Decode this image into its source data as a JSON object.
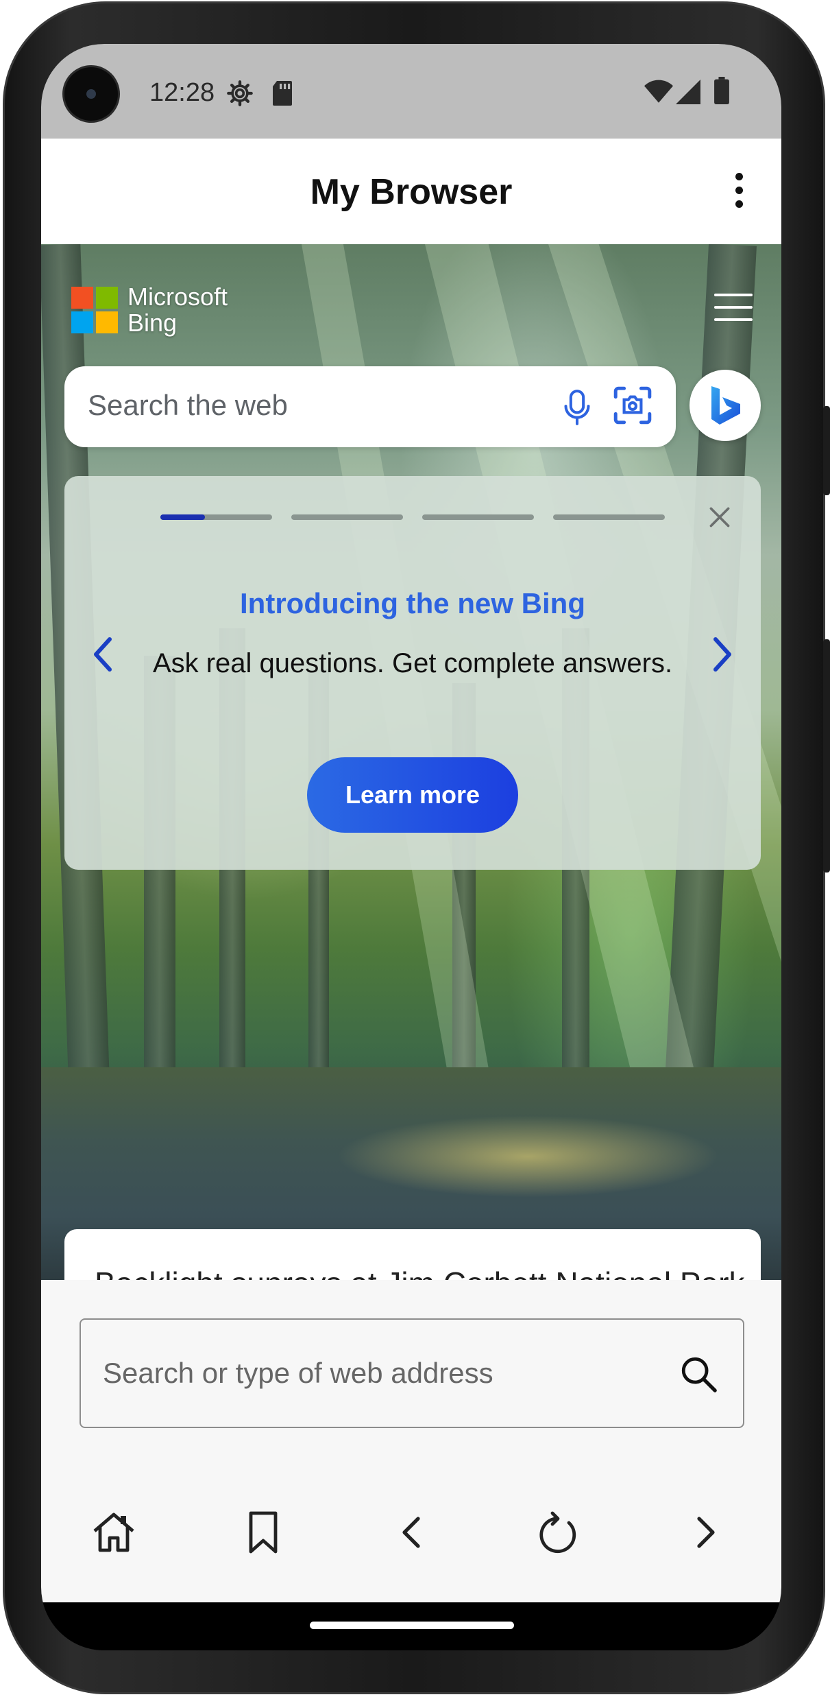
{
  "status_bar": {
    "time": "12:28"
  },
  "app_bar": {
    "title": "My Browser"
  },
  "bing": {
    "logo_line1": "Microsoft",
    "logo_line2": "Bing",
    "search_placeholder": "Search the web"
  },
  "promo": {
    "title": "Introducing the new Bing",
    "body": "Ask real questions. Get complete answers.",
    "button_label": "Learn more",
    "slide_count": 4,
    "current_slide": 1,
    "progress_fraction": 0.4
  },
  "image_caption": "Backlight sunrays at Jim Corbett National Park",
  "browser": {
    "address_placeholder": "Search or type of web address"
  },
  "colors": {
    "accent_blue": "#2d63e0",
    "button_blue": "#1c3fe0",
    "progress_active": "#1a2fb0",
    "ms_red": "#f25022",
    "ms_green": "#7fba00",
    "ms_blue": "#00a4ef",
    "ms_yellow": "#ffb900"
  },
  "icons": [
    "gear-icon",
    "sd-card-icon",
    "wifi-icon",
    "signal-icon",
    "battery-icon",
    "more-vert-icon",
    "hamburger-icon",
    "mic-icon",
    "visual-search-icon",
    "copilot-icon",
    "close-icon",
    "chevron-left-icon",
    "chevron-right-icon",
    "search-icon",
    "home-icon",
    "bookmark-icon",
    "back-icon",
    "refresh-icon",
    "forward-icon"
  ]
}
